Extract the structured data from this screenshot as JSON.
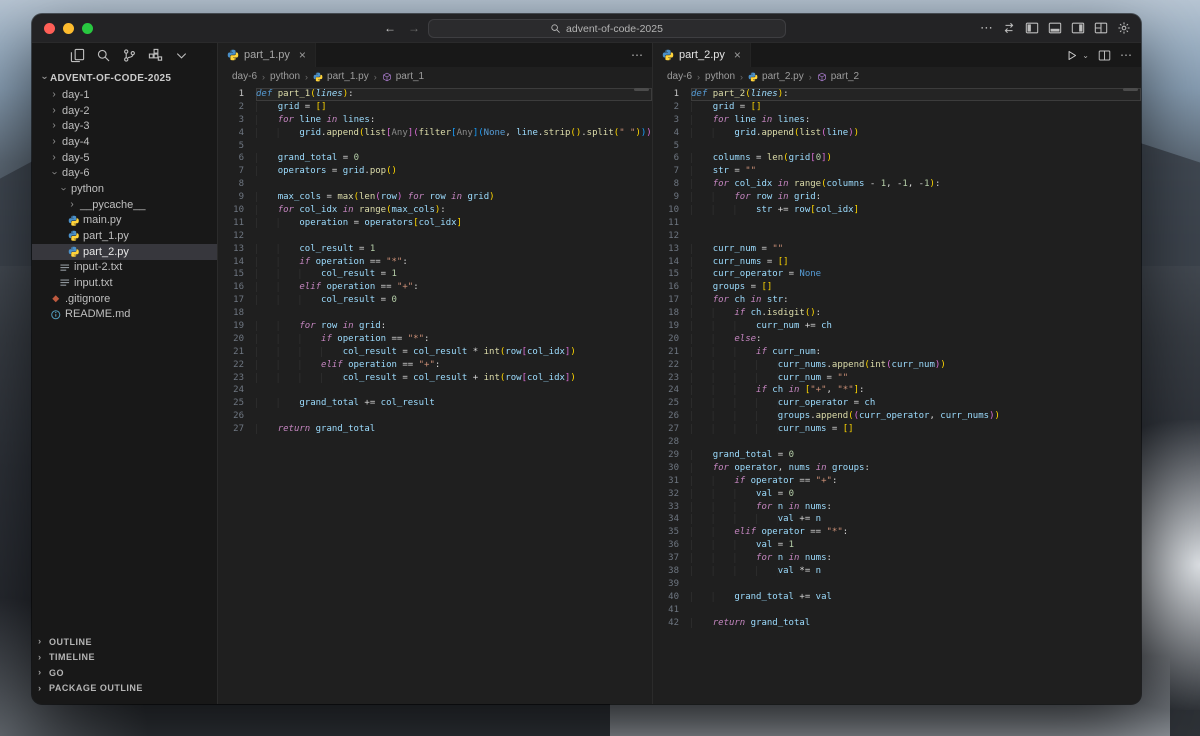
{
  "theme": {
    "traffic_red": "#ff5f57",
    "traffic_yellow": "#febc2e",
    "traffic_green": "#28c840",
    "selection_bg": "#37373d",
    "editor_bg": "#1f1f1f",
    "sidebar_bg": "#181818",
    "python_icon_blue": "#4a8fc7",
    "python_icon_yellow": "#ffd43b"
  },
  "titlebar": {
    "search_text": "advent-of-code-2025"
  },
  "icons": {
    "back": "←",
    "forward": "→",
    "more": "⋯",
    "close": "×",
    "chevron_right": "›",
    "chevron_down_small": "⌄"
  },
  "activity_bar": {
    "items": [
      "explorer",
      "search",
      "source-control",
      "extensions",
      "more"
    ]
  },
  "sidebar": {
    "root_label": "ADVENT-OF-CODE-2025",
    "items": [
      {
        "label": "day-1",
        "depth": 1,
        "chevron": "right"
      },
      {
        "label": "day-2",
        "depth": 1,
        "chevron": "right"
      },
      {
        "label": "day-3",
        "depth": 1,
        "chevron": "right"
      },
      {
        "label": "day-4",
        "depth": 1,
        "chevron": "right"
      },
      {
        "label": "day-5",
        "depth": 1,
        "chevron": "right"
      },
      {
        "label": "day-6",
        "depth": 1,
        "chevron": "down"
      },
      {
        "label": "python",
        "depth": 2,
        "chevron": "down"
      },
      {
        "label": "__pycache__",
        "depth": 3,
        "chevron": "right"
      },
      {
        "label": "main.py",
        "depth": 3,
        "icon": "python"
      },
      {
        "label": "part_1.py",
        "depth": 3,
        "icon": "python"
      },
      {
        "label": "part_2.py",
        "depth": 3,
        "icon": "python",
        "selected": true
      },
      {
        "label": "input-2.txt",
        "depth": 2,
        "icon": "text"
      },
      {
        "label": "input.txt",
        "depth": 2,
        "icon": "text"
      },
      {
        "label": ".gitignore",
        "depth": 1,
        "icon": "git"
      },
      {
        "label": "README.md",
        "depth": 1,
        "icon": "info"
      }
    ],
    "bottom_sections": [
      "OUTLINE",
      "TIMELINE",
      "GO",
      "PACKAGE OUTLINE"
    ]
  },
  "groups": [
    {
      "tab": "part_1.py",
      "active_line": 1,
      "breadcrumb": [
        {
          "label": "day-6"
        },
        {
          "label": "python"
        },
        {
          "label": "part_1.py",
          "icon": "python"
        },
        {
          "label": "part_1",
          "icon": "symbol"
        }
      ],
      "code": [
        "def part_1(lines):",
        "    grid = []",
        "    for line in lines:",
        "        grid.append(list[Any](filter[Any](None, line.strip().split(\" \"))))",
        "",
        "    grand_total = 0",
        "    operators = grid.pop()",
        "",
        "    max_cols = max(len(row) for row in grid)",
        "    for col_idx in range(max_cols):",
        "        operation = operators[col_idx]",
        "",
        "        col_result = 1",
        "        if operation == \"*\":",
        "            col_result = 1",
        "        elif operation == \"+\":",
        "            col_result = 0",
        "",
        "        for row in grid:",
        "            if operation == \"*\":",
        "                col_result = col_result * int(row[col_idx])",
        "            elif operation == \"+\":",
        "                col_result = col_result + int(row[col_idx])",
        "",
        "        grand_total += col_result",
        "",
        "    return grand_total"
      ]
    },
    {
      "tab": "part_2.py",
      "active_line": 1,
      "breadcrumb": [
        {
          "label": "day-6"
        },
        {
          "label": "python"
        },
        {
          "label": "part_2.py",
          "icon": "python"
        },
        {
          "label": "part_2",
          "icon": "symbol"
        }
      ],
      "code": [
        "def part_2(lines):",
        "    grid = []",
        "    for line in lines:",
        "        grid.append(list(line))",
        "",
        "    columns = len(grid[0])",
        "    str = \"\"",
        "    for col_idx in range(columns - 1, -1, -1):",
        "        for row in grid:",
        "            str += row[col_idx]",
        "",
        "",
        "    curr_num = \"\"",
        "    curr_nums = []",
        "    curr_operator = None",
        "    groups = []",
        "    for ch in str:",
        "        if ch.isdigit():",
        "            curr_num += ch",
        "        else:",
        "            if curr_num:",
        "                curr_nums.append(int(curr_num))",
        "                curr_num = \"\"",
        "            if ch in [\"+\", \"*\"]:",
        "                curr_operator = ch",
        "                groups.append((curr_operator, curr_nums))",
        "                curr_nums = []",
        "",
        "    grand_total = 0",
        "    for operator, nums in groups:",
        "        if operator == \"+\":",
        "            val = 0",
        "            for n in nums:",
        "                val += n",
        "        elif operator == \"*\":",
        "            val = 1",
        "            for n in nums:",
        "                val *= n",
        "",
        "        grand_total += val",
        "",
        "    return grand_total"
      ]
    }
  ]
}
